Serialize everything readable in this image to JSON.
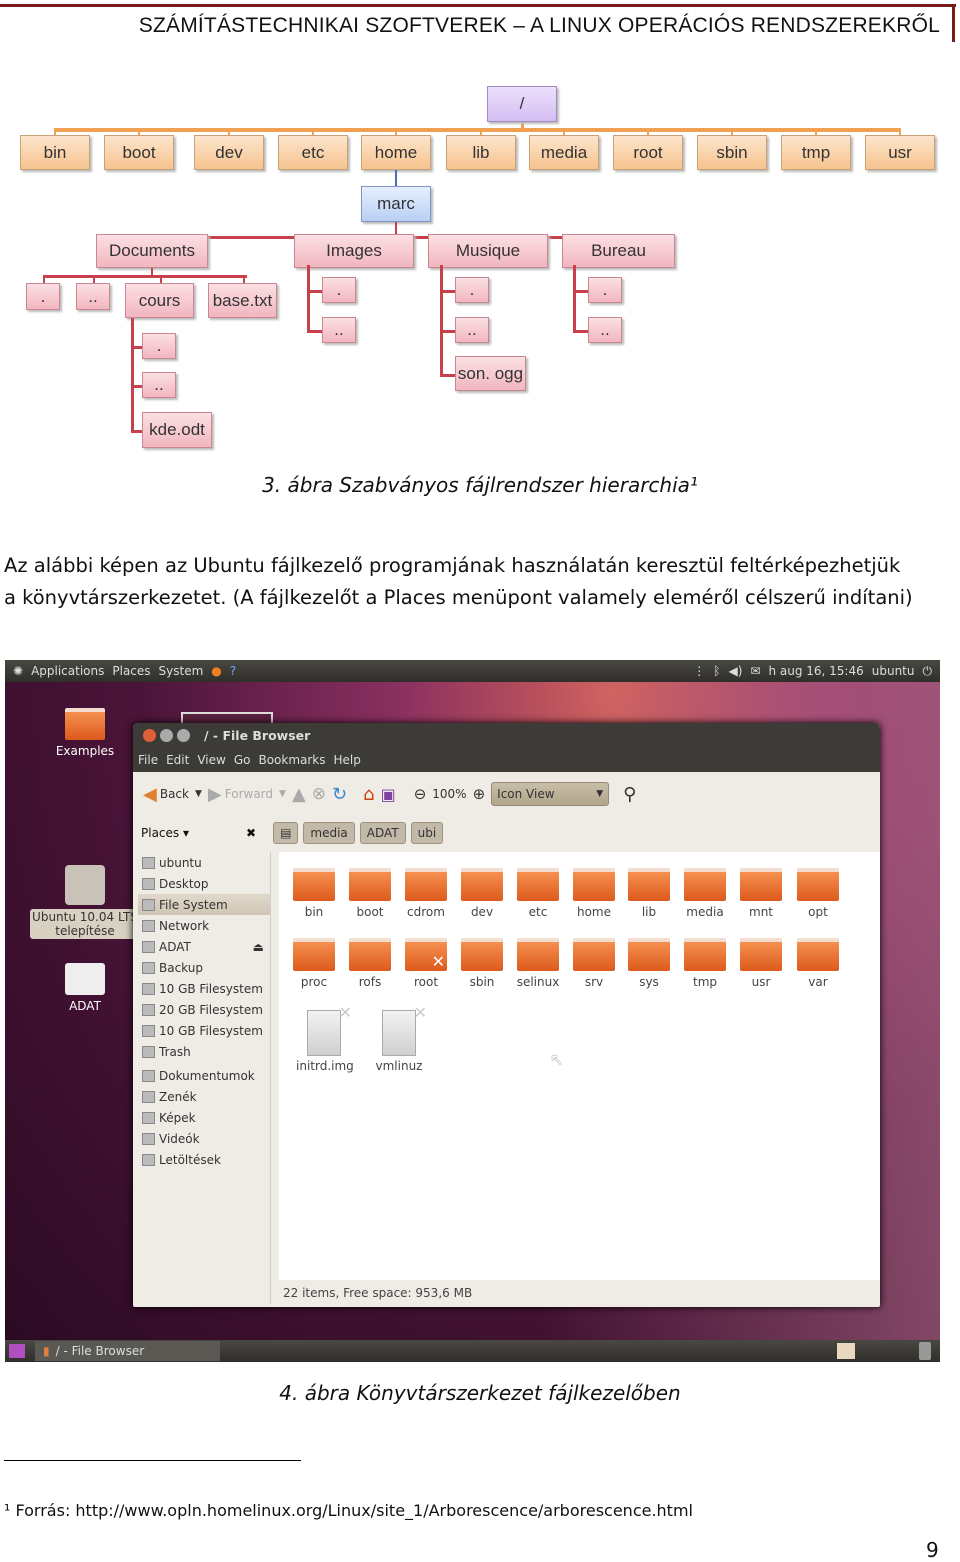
{
  "header": {
    "title": "SZÁMÍTÁSTECHNIKAI SZOFTVEREK – A LINUX OPERÁCIÓS RENDSZEREKRŐL",
    "accent": "#7a1a1a"
  },
  "tree": {
    "root": "/",
    "level1": [
      "bin",
      "boot",
      "dev",
      "etc",
      "home",
      "lib",
      "media",
      "root",
      "sbin",
      "tmp",
      "usr"
    ],
    "home_child": "marc",
    "marc_children": [
      "Documents",
      "Images",
      "Musique",
      "Bureau"
    ],
    "documents_children": [
      ".",
      "..",
      "cours",
      "base.txt"
    ],
    "cours_children": [
      ".",
      "..",
      "kde.odt"
    ],
    "images_children": [
      ".",
      ".."
    ],
    "musique_children": [
      ".",
      "..",
      "son. ogg"
    ],
    "bureau_children": [
      ".",
      ".."
    ]
  },
  "caption1": "3. ábra Szabványos fájlrendszer hierarchia¹",
  "paragraph": {
    "line1": "Az alábbi képen az Ubuntu fájlkezelő programjának használatán keresztül feltérképezhetjük",
    "line2": "a könyvtárszerkezetet. (A fájlkezelőt a Places menüpont valamely eleméről célszerű indítani)"
  },
  "screenshot": {
    "top_panel": {
      "menus": [
        "Applications",
        "Places",
        "System"
      ],
      "clock": "h aug 16, 15:46",
      "user": "ubuntu"
    },
    "desktop_icons": [
      "Examples",
      "Ubuntu 10.04 LTS telepítése",
      "ADAT"
    ],
    "window": {
      "title": "/ - File Browser",
      "menu": [
        "File",
        "Edit",
        "View",
        "Go",
        "Bookmarks",
        "Help"
      ],
      "toolbar": {
        "back": "Back",
        "forward": "Forward",
        "zoom": "100%",
        "view": "Icon View"
      },
      "location": {
        "places": "Places ▾",
        "crumbs": [
          "media",
          "ADAT",
          "ubi"
        ]
      },
      "sidebar": [
        "ubuntu",
        "Desktop",
        "File System",
        "Network",
        "ADAT",
        "Backup",
        "10 GB Filesystem",
        "20 GB Filesystem",
        "10 GB Filesystem",
        "Trash",
        "Dokumentumok",
        "Zenék",
        "Képek",
        "Videók",
        "Letöltések"
      ],
      "selected_sidebar": "File System",
      "files_row1": [
        "bin",
        "boot",
        "cdrom",
        "dev",
        "etc",
        "home",
        "lib",
        "media",
        "mnt",
        "opt"
      ],
      "files_row2": [
        "proc",
        "rofs",
        "root",
        "sbin",
        "selinux",
        "srv",
        "sys",
        "tmp",
        "usr",
        "var"
      ],
      "files_row3": [
        "initrd.img",
        "vmlinuz"
      ],
      "status": "22 items, Free space: 953,6 MB"
    },
    "taskbar": {
      "task": "/ - File Browser"
    }
  },
  "caption2": "4. ábra Könyvtárszerkezet fájlkezelőben",
  "footnote": "¹ Forrás: http://www.opln.homelinux.org/Linux/site_1/Arborescence/arborescence.html",
  "page_number": "9"
}
